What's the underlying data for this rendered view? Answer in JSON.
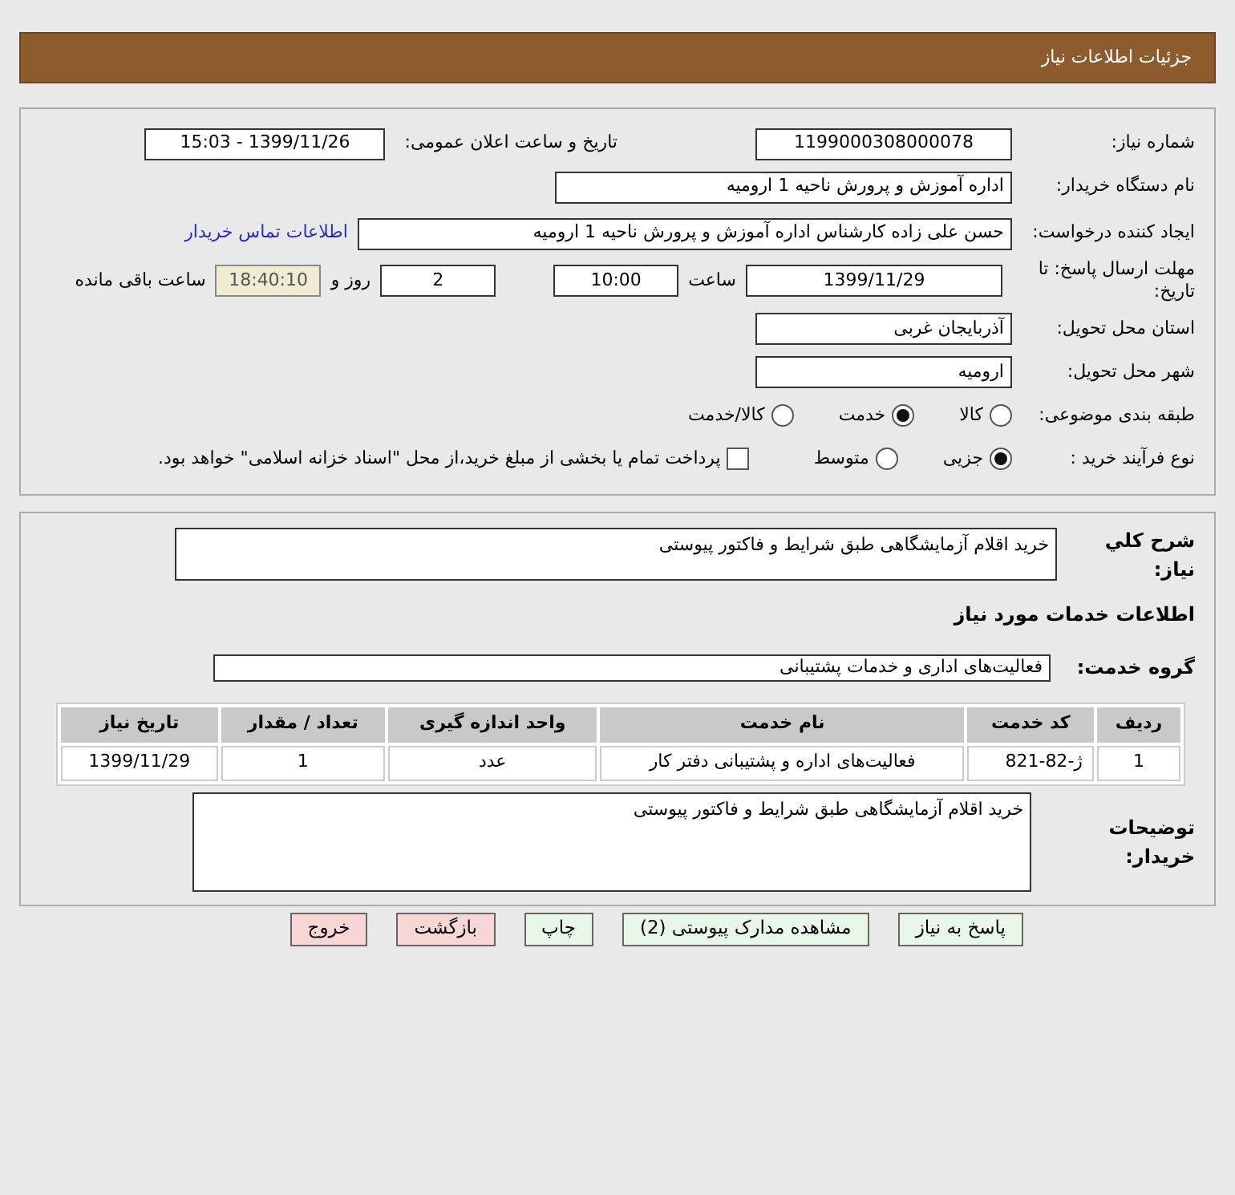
{
  "header": {
    "title": "جزئیات اطلاعات نیاز"
  },
  "need_number": {
    "label": "شماره نیاز:",
    "value": "1199000308000078"
  },
  "announce": {
    "label": "تاریخ و ساعت اعلان عمومی:",
    "value": "1399/11/26 - 15:03"
  },
  "buyer_org": {
    "label": "نام دستگاه خریدار:",
    "value": "اداره آموزش و پرورش ناحیه 1 ارومیه"
  },
  "requester": {
    "label": "ایجاد کننده درخواست:",
    "value": "حسن علی زاده کارشناس  اداره آموزش و پرورش ناحیه 1 ارومیه",
    "link": "اطلاعات تماس خریدار"
  },
  "deadline": {
    "label": "مهلت ارسال پاسخ: تا تاریخ:",
    "date": "1399/11/29",
    "time_label": "ساعت",
    "time": "10:00",
    "days": "2",
    "days_label": "روز و",
    "remaining": "18:40:10",
    "remaining_label": "ساعت باقی مانده"
  },
  "province": {
    "label": "استان محل تحویل:",
    "value": "آذربایجان غربی"
  },
  "city": {
    "label": "شهر محل تحویل:",
    "value": "ارومیه"
  },
  "category": {
    "label": "طبقه بندی موضوعی:",
    "options": [
      {
        "label": "کالا",
        "selected": false
      },
      {
        "label": "خدمت",
        "selected": true
      },
      {
        "label": "کالا/خدمت",
        "selected": false
      }
    ]
  },
  "process": {
    "label": "نوع فرآیند خرید :",
    "options": [
      {
        "label": "جزیی",
        "selected": true
      },
      {
        "label": "متوسط",
        "selected": false
      }
    ],
    "treasury": {
      "label": "پرداخت تمام یا بخشی از مبلغ خرید،از محل \"اسناد خزانه اسلامی\" خواهد بود.",
      "checked": false
    }
  },
  "summary": {
    "label": "شرح کلي نياز:",
    "value": "خرید اقلام آزمایشگاهی طبق شرایط و فاکتور پیوستی"
  },
  "services_heading": "اطلاعات خدمات مورد نیاز",
  "service_group": {
    "label": "گروه خدمت:",
    "value": "فعالیت‌های اداری و خدمات پشتیبانی"
  },
  "table": {
    "columns": [
      "ردیف",
      "کد خدمت",
      "نام خدمت",
      "واحد اندازه گیری",
      "تعداد / مقدار",
      "تاریخ نیاز"
    ],
    "rows": [
      [
        "1",
        "ژ-82-821",
        "فعالیت‌های اداره و پشتیبانی دفتر کار",
        "عدد",
        "1",
        "1399/11/29"
      ]
    ]
  },
  "buyer_notes": {
    "label": "توضیحات خریدار:",
    "value": "خرید اقلام آزمایشگاهی طبق شرایط و فاکتور پیوستی"
  },
  "buttons": [
    {
      "label": "پاسخ به نیاز",
      "kind": "action"
    },
    {
      "label": "مشاهده مدارک پیوستی (2)",
      "kind": "action"
    },
    {
      "label": "چاپ",
      "kind": "action"
    },
    {
      "label": "بازگشت",
      "kind": "exit"
    },
    {
      "label": "خروج",
      "kind": "exit"
    }
  ]
}
